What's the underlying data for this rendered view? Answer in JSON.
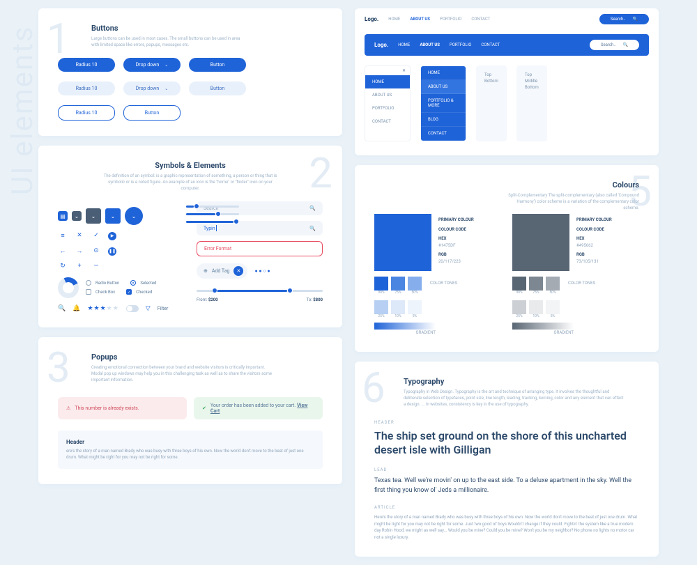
{
  "watermark": "UI elements",
  "s1": {
    "num": "1",
    "title": "Buttons",
    "sub": "Large buttons can be used in most cases. The small buttons can be used in area with limited space like errors, popups, messages etc.",
    "radius": "Radius 10",
    "dropdown": "Drop down",
    "button": "Button"
  },
  "s2": {
    "num": "2",
    "title": "Symbols & Elements",
    "sub": "The definition of an symbol: is a graphic representation of something, a person or thing that is symbolic or is a noted figure. An example of an icon is the \"home\" or \"finder\" icon on your computer.",
    "search": "Search",
    "typing": "Typin",
    "error": "Error Format",
    "radio": "Radio Button",
    "selected": "Selected",
    "checkbox": "Check Box",
    "checked": "Checked",
    "addtag": "Add Tag",
    "filter": "Filter",
    "from": "From:",
    "fromv": "$200",
    "to": "To:",
    "tov": "$800"
  },
  "s3": {
    "num": "3",
    "title": "Popups",
    "sub": "Creating emotional connection between your brand and website visitors is critically important. Modal pop up windows may help you in this challenging task as well as to share the visitors some important information.",
    "err": "This number is already exists.",
    "ok": "Your order has been added to your cart.",
    "view": "View Cart",
    "header": "Header",
    "body": "ere's the story of a man named Brady who was busy with three boys of his own. Now the world don't move to the beat of just one drum. What might be right for you may not be right for some."
  },
  "s4": {
    "logo": "Logo.",
    "nav": [
      "HOME",
      "ABOUT US",
      "PORTFOLIO",
      "CONTACT"
    ],
    "search": "Search..",
    "menu1": [
      "HOME",
      "ABOUT US",
      "PORTFOLIO",
      "CONTACT"
    ],
    "menu2": [
      "HOME",
      "ABOUT US",
      "PORTFOLIO & MORE",
      "BLOG",
      "CONTACT"
    ],
    "pop1": [
      "Top",
      "Bottom"
    ],
    "pop2": [
      "Top",
      "Middle",
      "Bottom"
    ]
  },
  "s5": {
    "num": "5",
    "title": "Colours",
    "sub": "Split-Complementary The split-complementary (also called 'Compound Harmony') color scheme is a variation of the complementary color scheme.",
    "primary": "PRIMARY COLOUR",
    "code": "COLOUR CODE",
    "hex": "HEX",
    "rgb": "RGB",
    "c1": {
      "hex": "#1475DF",
      "rgb": "20/117/223"
    },
    "c2": {
      "hex": "#495662",
      "rgb": "73/105/131"
    },
    "tones": "COLOR TONES",
    "grad": "GRADIENT",
    "pct": [
      "90%",
      "75%",
      "50%",
      "25%",
      "10%",
      "5%"
    ]
  },
  "s6": {
    "num": "6",
    "title": "Typography",
    "sub": "Typography in Web Design. Typography is the art and technique of arranging type. It involves the thoughtful and deliberate selection of typefaces, point size, line length, leading, tracking, kerning, color and any element that can effect a design. ... In websites, consistency is key in the use of typography.",
    "header_l": "HEADER",
    "header_t": "The ship set ground on the shore of this uncharted desert isle with Gilligan",
    "lead_l": "LEAD",
    "lead_t": "Texas tea. Well we're movin' on up to the east side. To a deluxe apartment in the sky. Well the first thing you know ol' Jeds a millionaire.",
    "art_l": "ARTICLE",
    "art_t": "Here's the story of a man named Brady who was busy with three boys of his own. Now the world don't move to the beat of just one drum. What might be right for you may not be right for some. Just two good ol' boys Wouldn't change if they could. Fightin' the system like a true modern day Robin Hood, we might as well say... Would you be mine? Could you be mine? Won't you be my neighbor? No phone no lights no motor car not a single luxury."
  }
}
